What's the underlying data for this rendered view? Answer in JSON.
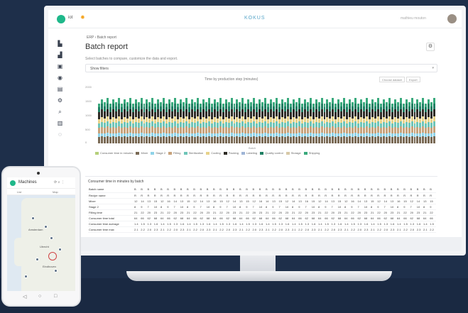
{
  "desktop": {
    "topbar": {
      "logo_text": "iot",
      "brand": "KOKUS",
      "user_text": "mathieu mouton"
    },
    "breadcrumb": "ERP › Batch report",
    "page_title": "Batch report",
    "gear_icon": "gear-icon",
    "hint": "Select batches to compare, customize the data and export.",
    "select": {
      "value": "Show filters",
      "caret": "▾"
    },
    "chart": {
      "title": "Time by production step (minutes)",
      "dropdowns": [
        "Choose dataset",
        "Export"
      ],
      "yticks": [
        "2000",
        "1500",
        "1000",
        "500",
        "0"
      ],
      "xlabel": "Batch",
      "legend": [
        {
          "label": "Consumer time in minutes",
          "color": "#b5cf7a"
        },
        {
          "label": "Mixer",
          "color": "#7a6a55"
        },
        {
          "label": "Stage 2",
          "color": "#8fd3e8"
        },
        {
          "label": "Filling",
          "color": "#c7a27b"
        },
        {
          "label": "Sterilization",
          "color": "#6ec5b8"
        },
        {
          "label": "Cooling",
          "color": "#e7d28a"
        },
        {
          "label": "Packing",
          "color": "#2e2b26"
        },
        {
          "label": "Labeling",
          "color": "#9fb5d6"
        },
        {
          "label": "Quality control",
          "color": "#1f7f63"
        },
        {
          "label": "Storage",
          "color": "#d7c9a7"
        },
        {
          "label": "Shipping",
          "color": "#39a97c"
        }
      ]
    },
    "table": {
      "header": "Consumer time in minutes by batch",
      "rows": [
        {
          "label": "Batch name",
          "cells": [
            "B",
            "B",
            "B",
            "B",
            "B",
            "B",
            "B",
            "B",
            "B",
            "B",
            "B",
            "B",
            "B",
            "B",
            "B",
            "B",
            "B",
            "B",
            "B",
            "B",
            "B",
            "B",
            "B",
            "B",
            "B",
            "B",
            "B",
            "B",
            "B",
            "B",
            "B",
            "B",
            "B",
            "B",
            "B",
            "B",
            "B",
            "B",
            "B",
            "B",
            "B",
            "B",
            "B",
            "B",
            "B",
            "B"
          ]
        },
        {
          "label": "Recipe name",
          "cells": [
            "R",
            "R",
            "R",
            "R",
            "R",
            "R",
            "R",
            "R",
            "R",
            "R",
            "R",
            "R",
            "R",
            "R",
            "R",
            "R",
            "R",
            "R",
            "R",
            "R",
            "R",
            "R",
            "R",
            "R",
            "R",
            "R",
            "R",
            "R",
            "R",
            "R",
            "R",
            "R",
            "R",
            "R",
            "R",
            "R",
            "R",
            "R",
            "R",
            "R",
            "R",
            "R",
            "R",
            "R",
            "R",
            "R"
          ]
        },
        {
          "label": "Mixer",
          "cells": [
            "12",
            "14",
            "13",
            "15",
            "12",
            "16",
            "14",
            "13",
            "15",
            "12",
            "14",
            "13",
            "16",
            "15",
            "12",
            "14",
            "13",
            "15",
            "12",
            "16",
            "14",
            "13",
            "15",
            "12",
            "14",
            "13",
            "16",
            "15",
            "12",
            "14",
            "13",
            "15",
            "12",
            "16",
            "14",
            "13",
            "15",
            "12",
            "14",
            "13",
            "16",
            "15",
            "12",
            "14",
            "13",
            "15"
          ]
        },
        {
          "label": "Stage 2",
          "cells": [
            "8",
            "9",
            "7",
            "10",
            "8",
            "9",
            "7",
            "10",
            "8",
            "9",
            "7",
            "10",
            "8",
            "9",
            "7",
            "10",
            "8",
            "9",
            "7",
            "10",
            "8",
            "9",
            "7",
            "10",
            "8",
            "9",
            "7",
            "10",
            "8",
            "9",
            "7",
            "10",
            "8",
            "9",
            "7",
            "10",
            "8",
            "9",
            "7",
            "10",
            "8",
            "9",
            "7",
            "10",
            "8",
            "9"
          ]
        },
        {
          "label": "Filling time",
          "cells": [
            "21",
            "22",
            "20",
            "23",
            "21",
            "22",
            "20",
            "23",
            "21",
            "22",
            "20",
            "23",
            "21",
            "22",
            "20",
            "23",
            "21",
            "22",
            "20",
            "23",
            "21",
            "22",
            "20",
            "23",
            "21",
            "22",
            "20",
            "23",
            "21",
            "22",
            "20",
            "23",
            "21",
            "22",
            "20",
            "23",
            "21",
            "22",
            "20",
            "23",
            "21",
            "22",
            "20",
            "23",
            "21",
            "22"
          ]
        },
        {
          "label": "Consumer time total",
          "cells": [
            "64",
            "66",
            "62",
            "68",
            "64",
            "66",
            "62",
            "68",
            "64",
            "66",
            "62",
            "68",
            "64",
            "66",
            "62",
            "68",
            "64",
            "66",
            "62",
            "68",
            "64",
            "66",
            "62",
            "68",
            "64",
            "66",
            "62",
            "68",
            "64",
            "66",
            "62",
            "68",
            "64",
            "66",
            "62",
            "68",
            "64",
            "66",
            "62",
            "68",
            "64",
            "66",
            "62",
            "68",
            "64",
            "66"
          ]
        },
        {
          "label": "Consumer time average",
          "cells": [
            "1.4",
            "1.5",
            "1.3",
            "1.6",
            "1.4",
            "1.5",
            "1.3",
            "1.6",
            "1.4",
            "1.5",
            "1.3",
            "1.6",
            "1.4",
            "1.5",
            "1.3",
            "1.6",
            "1.4",
            "1.5",
            "1.3",
            "1.6",
            "1.4",
            "1.5",
            "1.3",
            "1.6",
            "1.4",
            "1.5",
            "1.3",
            "1.6",
            "1.4",
            "1.5",
            "1.3",
            "1.6",
            "1.4",
            "1.5",
            "1.3",
            "1.6",
            "1.4",
            "1.5",
            "1.3",
            "1.6",
            "1.4",
            "1.5",
            "1.3",
            "1.6",
            "1.4",
            "1.5"
          ]
        },
        {
          "label": "Consumer time max",
          "cells": [
            "2.1",
            "2.2",
            "2.0",
            "2.3",
            "2.1",
            "2.2",
            "2.0",
            "2.3",
            "2.1",
            "2.2",
            "2.0",
            "2.3",
            "2.1",
            "2.2",
            "2.0",
            "2.3",
            "2.1",
            "2.2",
            "2.0",
            "2.3",
            "2.1",
            "2.2",
            "2.0",
            "2.3",
            "2.1",
            "2.2",
            "2.0",
            "2.3",
            "2.1",
            "2.2",
            "2.0",
            "2.3",
            "2.1",
            "2.2",
            "2.0",
            "2.3",
            "2.1",
            "2.2",
            "2.0",
            "2.3",
            "2.1",
            "2.2",
            "2.0",
            "2.3",
            "2.1",
            "2.2"
          ]
        }
      ]
    }
  },
  "phone": {
    "title": "Machines",
    "icons": "⟳  ⌕  ⋮",
    "tabs": [
      "List",
      "Map"
    ],
    "cities": [
      "Amsterdam",
      "Utrecht",
      "Eindhoven"
    ],
    "nav": [
      "◁",
      "○",
      "□"
    ]
  },
  "chart_data": {
    "type": "bar",
    "stacked": true,
    "title": "Time by production step (minutes)",
    "xlabel": "Batch",
    "ylabel": "",
    "ylim": [
      0,
      2000
    ],
    "categories_count": 120,
    "series": [
      {
        "name": "Mixer",
        "values_pattern": [
          230,
          250,
          220,
          260
        ]
      },
      {
        "name": "Stage 2",
        "values_pattern": [
          120,
          130,
          110,
          140
        ]
      },
      {
        "name": "Filling",
        "values_pattern": [
          200,
          210,
          190,
          220
        ]
      },
      {
        "name": "Sterilization",
        "values_pattern": [
          180,
          170,
          190,
          160
        ]
      },
      {
        "name": "Cooling",
        "values_pattern": [
          150,
          160,
          140,
          170
        ]
      },
      {
        "name": "Packing",
        "values_pattern": [
          260,
          240,
          270,
          250
        ]
      },
      {
        "name": "Quality control",
        "values_pattern": [
          180,
          200,
          170,
          210
        ]
      },
      {
        "name": "Shipping",
        "values_pattern": [
          160,
          150,
          180,
          140
        ]
      }
    ]
  }
}
